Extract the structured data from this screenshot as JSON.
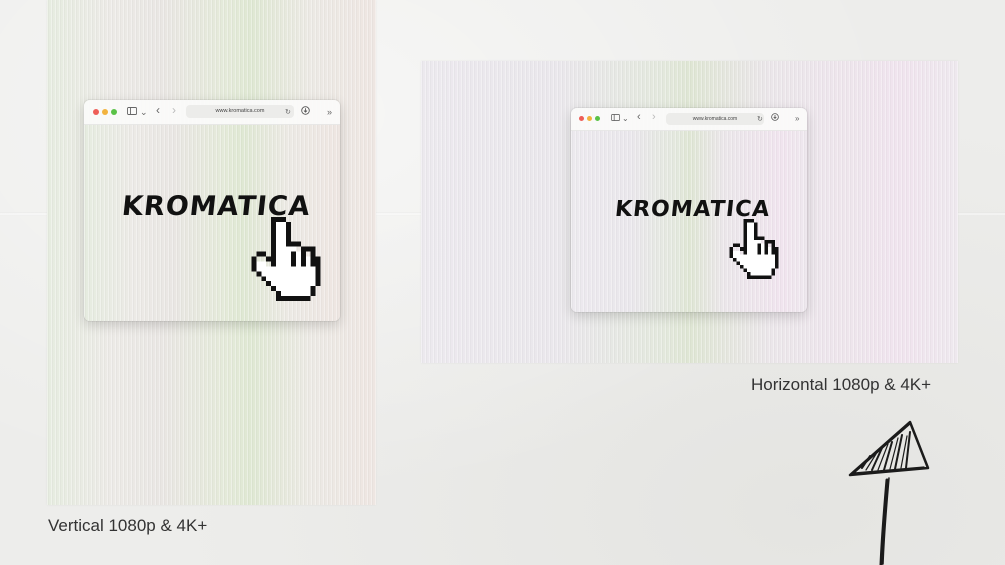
{
  "vertical": {
    "url": "www.kromatica.com",
    "logo_text": "KROMATICA",
    "caption": "Vertical 1080p & 4K+"
  },
  "horizontal": {
    "url": "www.kromatica.com",
    "logo_text": "KROMATICA",
    "caption": "Horizontal 1080p & 4K+"
  },
  "icons": {
    "sidebar": "sidebar-toggle-icon",
    "chevron": "chevron-down-icon",
    "back": "back-arrow-icon",
    "forward": "forward-arrow-icon",
    "reload": "reload-icon",
    "download": "download-icon",
    "more": "more-chevrons-icon",
    "cursor": "hand-pointer-icon",
    "arrow": "hand-drawn-arrow-icon"
  },
  "colors": {
    "traffic_red": "#ee5e57",
    "traffic_yellow": "#f2b33e",
    "traffic_green": "#5ac246",
    "logo": "#111111"
  }
}
